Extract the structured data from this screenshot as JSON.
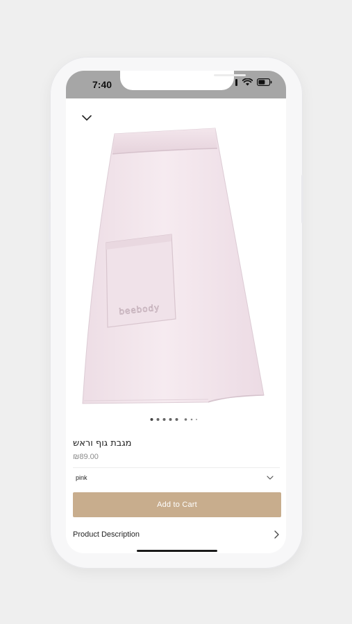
{
  "status_bar": {
    "time": "7:40",
    "icons": [
      "signal-icon",
      "wifi-icon",
      "battery-icon"
    ]
  },
  "product": {
    "image_alt": "pink body wrap towel with pocket",
    "pocket_embroidery": "beebody",
    "title": "מגבת גוף וראש",
    "price": "₪89.00",
    "variant": {
      "selected": "pink"
    },
    "gallery": {
      "count": 8,
      "active_index": 0
    }
  },
  "actions": {
    "add_to_cart": "Add to Cart",
    "product_description": "Product Description"
  },
  "colors": {
    "accent": "#c8ad8d",
    "status_bar": "#a6a6a6",
    "towel": "#f1e3ea"
  }
}
